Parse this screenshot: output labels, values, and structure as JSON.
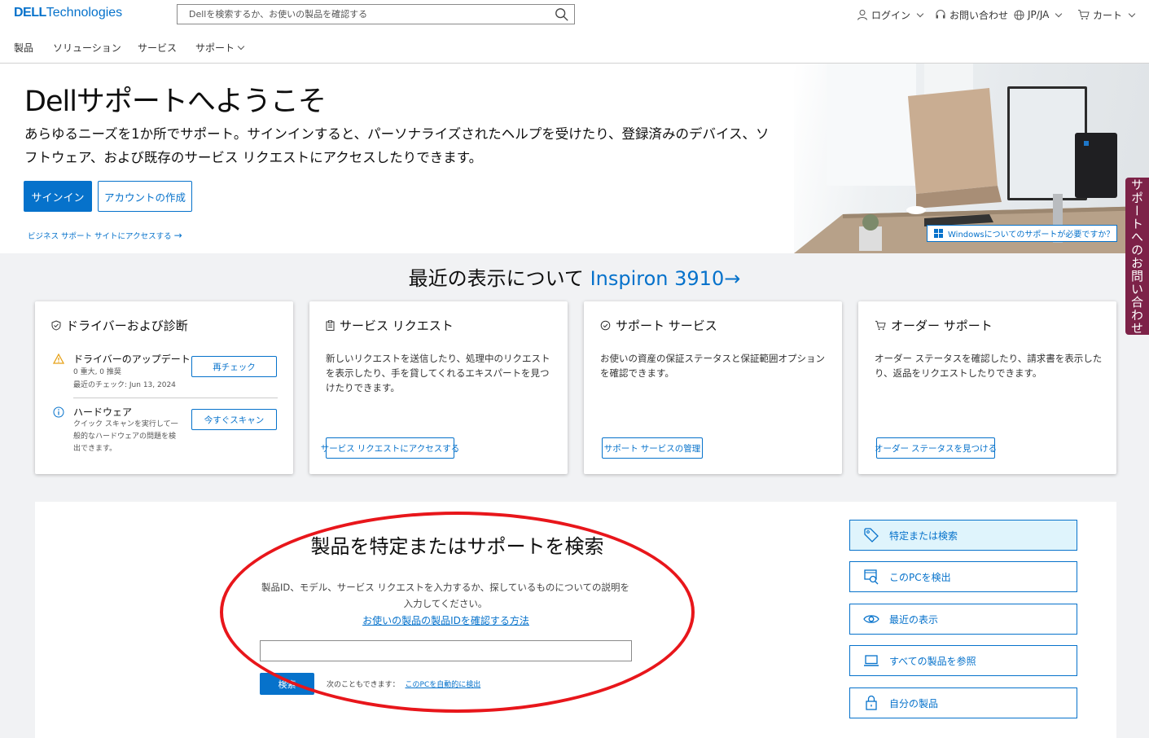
{
  "header": {
    "logo_brand": "DELL",
    "logo_rest": "Technologies",
    "search_placeholder": "Dellを検索するか、お使いの製品を確認する",
    "login": "ログイン",
    "contact": "お問い合わせ",
    "locale": "JP/JA",
    "cart": "カート"
  },
  "nav": {
    "products": "製品",
    "solutions": "ソリューション",
    "services": "サービス",
    "support": "サポート"
  },
  "hero": {
    "title": "Dellサポートへようこそ",
    "description": "あらゆるニーズを1か所でサポート。サインインすると、パーソナライズされたヘルプを受けたり、登録済みのデバイス、ソフトウェア、および既存のサービス リクエストにアクセスしたりできます。",
    "sign_in": "サインイン",
    "create_account": "アカウントの作成",
    "business_link": "ビジネス サポート サイトにアクセスする",
    "windows_badge": "Windowsについてのサポートが必要ですか？"
  },
  "side_tab": "サポートへのお問い合わせ",
  "recent": {
    "prefix": "最近の表示について",
    "product": "Inspiron 3910"
  },
  "cards": {
    "drivers": {
      "title": "ドライバーおよび診断",
      "update_title": "ドライバーのアップデート",
      "update_counts": "0 重大, 0 推奨",
      "update_last": "最近のチェック: Jun 13, 2024",
      "recheck": "再チェック",
      "hw_title": "ハードウェア",
      "hw_desc": "クイック スキャンを実行して一般的なハードウェアの問題を検出できます。",
      "scan": "今すぐスキャン"
    },
    "service_request": {
      "title": "サービス リクエスト",
      "desc": "新しいリクエストを送信したり、処理中のリクエストを表示したり、手を貸してくれるエキスパートを見つけたりできます。",
      "button": "サービス リクエストにアクセスする"
    },
    "support_service": {
      "title": "サポート サービス",
      "desc": "お使いの資産の保証ステータスと保証範囲オプションを確認できます。",
      "button": "サポート サービスの管理"
    },
    "order_support": {
      "title": "オーダー サポート",
      "desc": "オーダー ステータスを確認したり、請求書を表示したり、返品をリクエストしたりできます。",
      "button": "オーダー ステータスを見つける"
    }
  },
  "identify": {
    "title": "製品を特定またはサポートを検索",
    "desc": "製品ID、モデル、サービス リクエストを入力するか、探しているものについての説明を入力してください。",
    "how_link": "お使いの製品の製品IDを確認する方法",
    "input_value": "",
    "search_button": "検索",
    "also_text": "次のこともできます：",
    "auto_detect": "このPCを自動的に検出"
  },
  "quick_links": [
    {
      "label": "特定または検索",
      "icon": "tag-icon",
      "active": true
    },
    {
      "label": "このPCを検出",
      "icon": "detect-pc-icon",
      "active": false
    },
    {
      "label": "最近の表示",
      "icon": "eye-icon",
      "active": false
    },
    {
      "label": "すべての製品を参照",
      "icon": "laptop-icon",
      "active": false
    },
    {
      "label": "自分の製品",
      "icon": "lock-icon",
      "active": false
    }
  ],
  "colors": {
    "accent": "#0672cb",
    "side_tab": "#7d2248",
    "annotation": "#e8161b",
    "warning": "#e6a117"
  }
}
